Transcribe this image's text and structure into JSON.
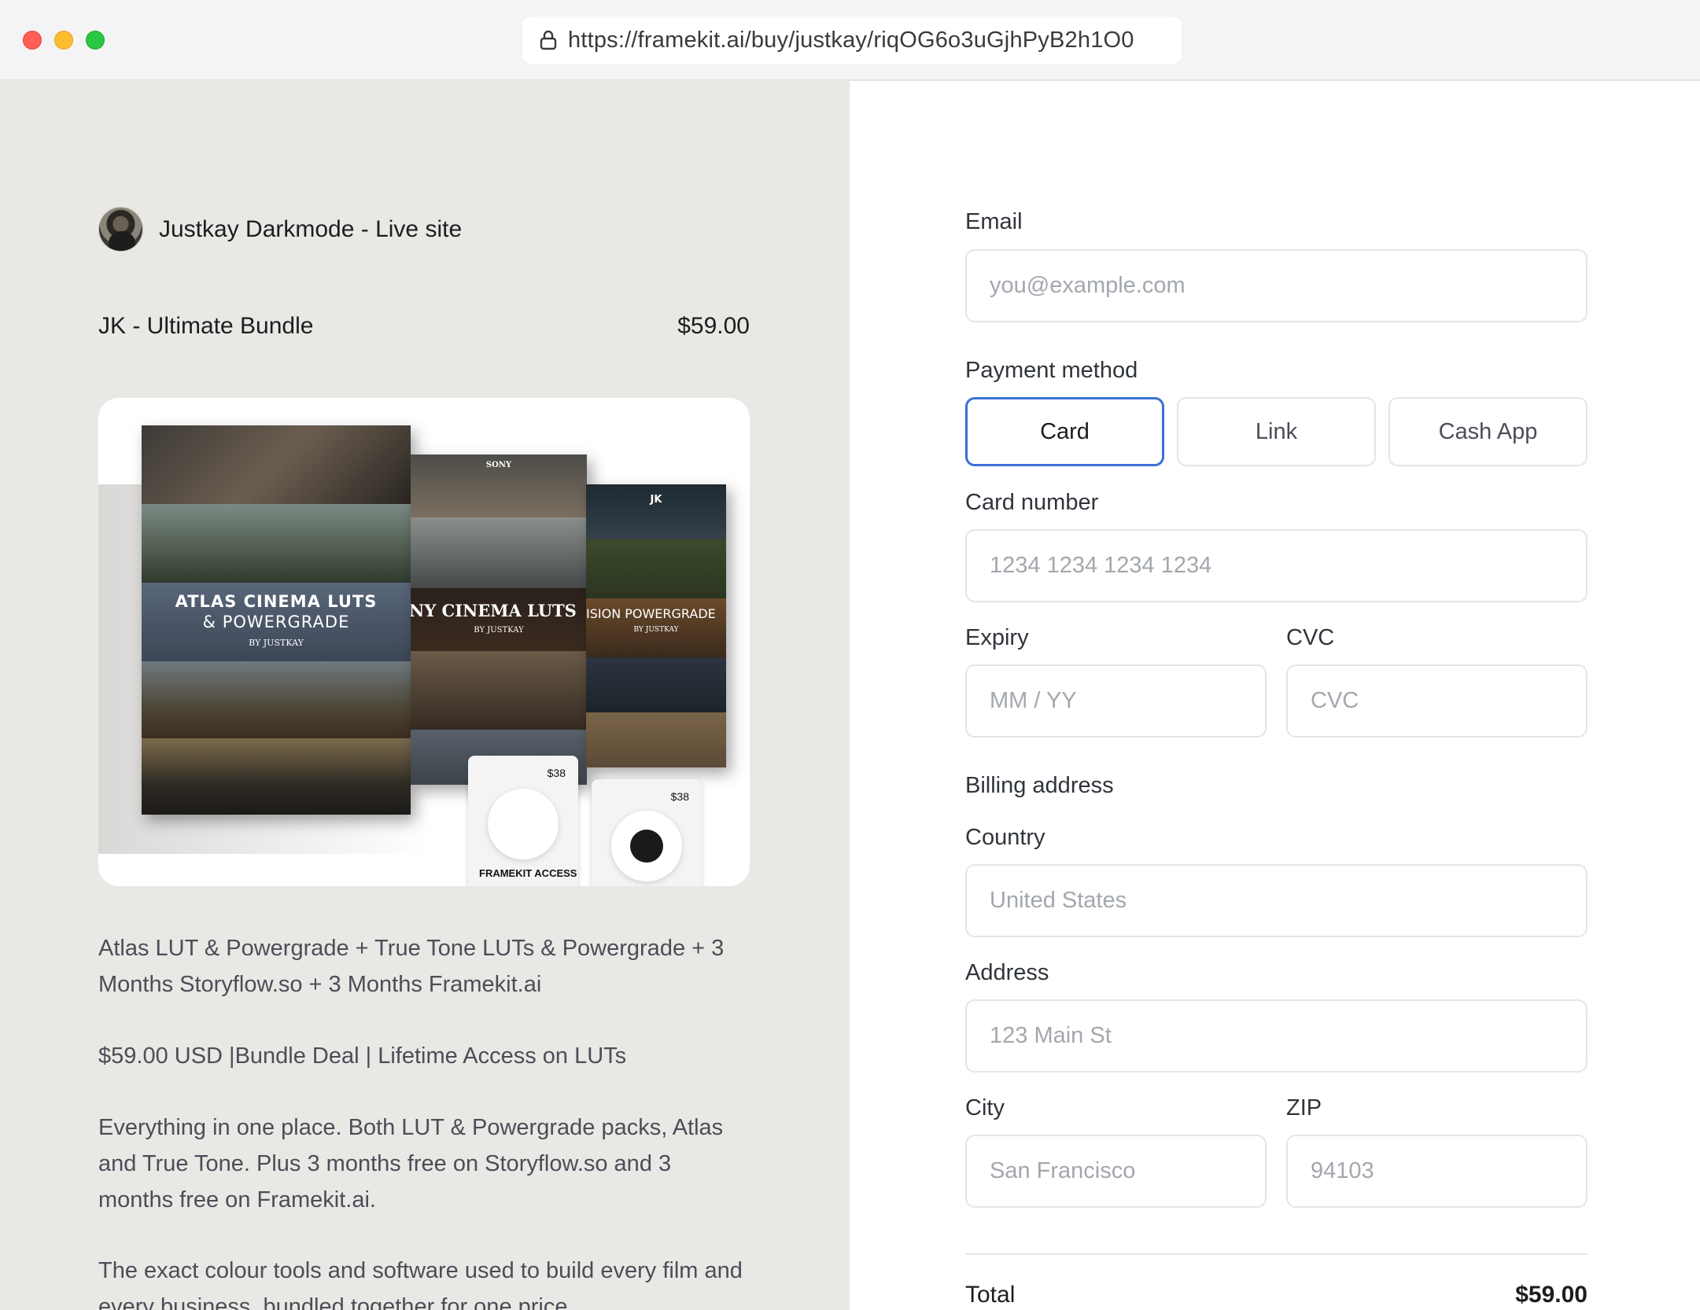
{
  "browser": {
    "url": "https://framekit.ai/buy/justkay/riqOG6o3uGjhPyB2h1O0"
  },
  "seller": {
    "name": "Justkay Darkmode - Live site"
  },
  "product": {
    "name": "JK - Ultimate Bundle",
    "price": "$59.00",
    "image": {
      "panel1_title_line1": "ATLAS CINEMA LUTS",
      "panel1_title_line2": "& POWERGRADE",
      "panel1_byline": "BY JUSTKAY",
      "panel2_top": "SONY",
      "panel2_title": "NY CINEMA LUTS",
      "panel2_byline": "BY JUSTKAY",
      "panel3_top": "JK",
      "panel3_title": "ISION POWERGRADE",
      "panel3_byline": "BY JUSTKAY",
      "card1_price": "$38",
      "card1_label": "FRAMEKIT ACCESS",
      "card2_price": "$38"
    },
    "description": [
      "Atlas LUT & Powergrade + True Tone LUTs & Powergrade + 3 Months Storyflow.so + 3 Months Framekit.ai",
      "$59.00 USD |Bundle Deal | Lifetime Access on LUTs",
      "Everything in one place. Both LUT & Powergrade packs, Atlas and True Tone. Plus 3 months free on Storyflow.so and 3 months free on Framekit.ai.",
      "The exact colour tools and software used to build every film and every business, bundled together for one price."
    ]
  },
  "form": {
    "email_label": "Email",
    "email_placeholder": "you@example.com",
    "payment_method_label": "Payment method",
    "payment_methods": [
      "Card",
      "Link",
      "Cash App"
    ],
    "selected_payment_method": "Card",
    "card_number_label": "Card number",
    "card_number_placeholder": "1234 1234 1234 1234",
    "expiry_label": "Expiry",
    "expiry_placeholder": "MM / YY",
    "cvc_label": "CVC",
    "cvc_placeholder": "CVC",
    "billing_address_label": "Billing address",
    "country_label": "Country",
    "country_value": "United States",
    "address_label": "Address",
    "address_placeholder": "123 Main St",
    "city_label": "City",
    "city_placeholder": "San Francisco",
    "zip_label": "ZIP",
    "zip_placeholder": "94103"
  },
  "summary": {
    "total_label": "Total",
    "total_value": "$59.00"
  },
  "colors": {
    "left_bg": "#e9e8e5",
    "right_bg": "#ffffff",
    "accent": "#3b6fd4"
  },
  "icons": {
    "lock": "lock-icon"
  }
}
